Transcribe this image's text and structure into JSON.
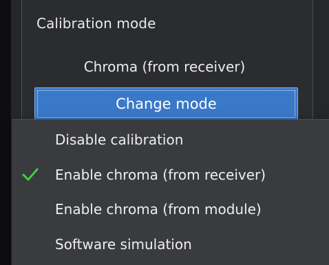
{
  "group": {
    "title": "Calibration mode",
    "current_mode": "Chroma (from receiver)",
    "change_button_label": "Change mode"
  },
  "menu": {
    "items": [
      {
        "label": "Disable calibration",
        "checked": false
      },
      {
        "label": "Enable chroma (from receiver)",
        "checked": true
      },
      {
        "label": "Enable chroma (from module)",
        "checked": false
      },
      {
        "label": "Software simulation",
        "checked": false
      }
    ],
    "check_icon": "check-icon",
    "check_color": "#3ad13a"
  },
  "colors": {
    "accent_button": "#3a78c8",
    "menu_background": "#3a3b3f",
    "panel_background": "#2b2c2f"
  }
}
